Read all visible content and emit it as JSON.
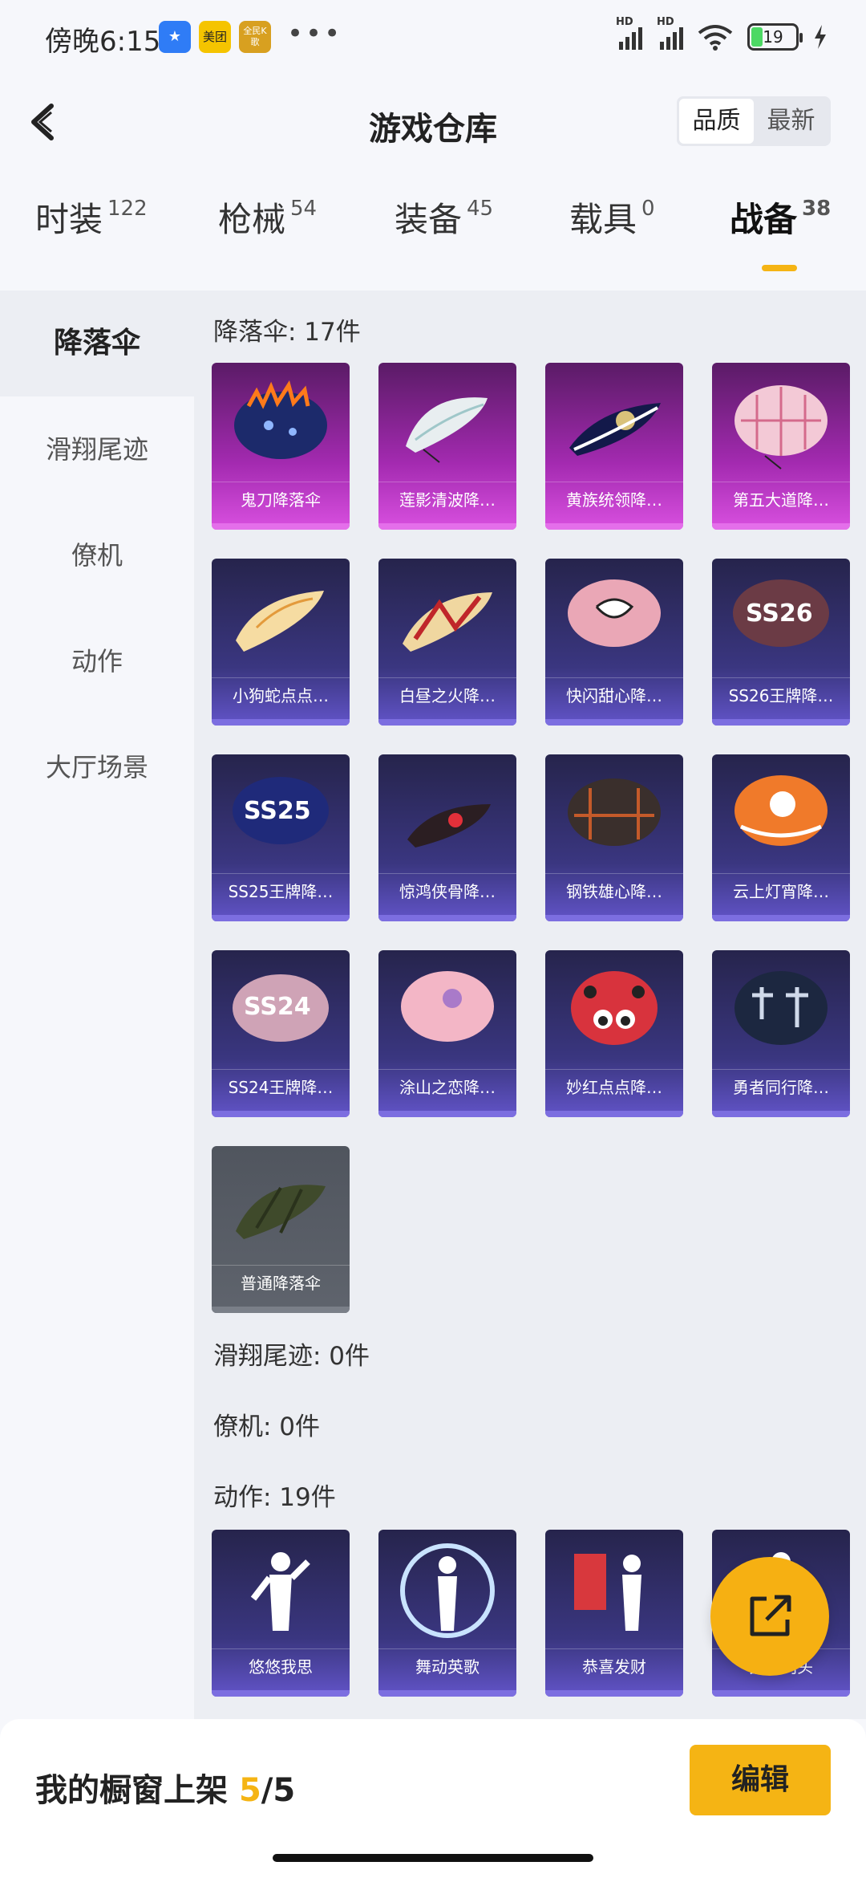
{
  "status": {
    "time": "傍晚6:15",
    "battery": "19",
    "apps": [
      "美团",
      "全民K歌"
    ]
  },
  "header": {
    "title": "游戏仓库",
    "sort": [
      "品质",
      "最新"
    ]
  },
  "tabs": [
    {
      "label": "时装",
      "count": "122"
    },
    {
      "label": "枪械",
      "count": "54"
    },
    {
      "label": "装备",
      "count": "45"
    },
    {
      "label": "载具",
      "count": "0"
    },
    {
      "label": "战备",
      "count": "38"
    }
  ],
  "sidebar": [
    "降落伞",
    "滑翔尾迹",
    "僚机",
    "动作",
    "大厅场景"
  ],
  "sections": {
    "parachute": "降落伞: 17件",
    "glide": "滑翔尾迹: 0件",
    "wingman": "僚机: 0件",
    "action": "动作: 19件"
  },
  "parachutes": [
    "鬼刀降落伞",
    "莲影清波降…",
    "黄族统领降…",
    "第五大道降…",
    "小狗蛇点点…",
    "白昼之火降…",
    "快闪甜心降…",
    "SS26王牌降…",
    "SS25王牌降…",
    "惊鸿侠骨降…",
    "钢铁雄心降…",
    "云上灯宵降…",
    "SS24王牌降…",
    "涂山之恋降…",
    "妙红点点降…",
    "勇者同行降…",
    "普通降落伞"
  ],
  "actions": [
    "悠悠我思",
    "舞动英歌",
    "恭喜发财",
    "晶晶闪头"
  ],
  "bottom": {
    "label": "我的橱窗上架 ",
    "current": "5",
    "total": "/5",
    "edit": "编辑"
  },
  "colors": {
    "accent": "#f5b414",
    "legendary": "#a32ab0",
    "epic": "#3a3680"
  }
}
